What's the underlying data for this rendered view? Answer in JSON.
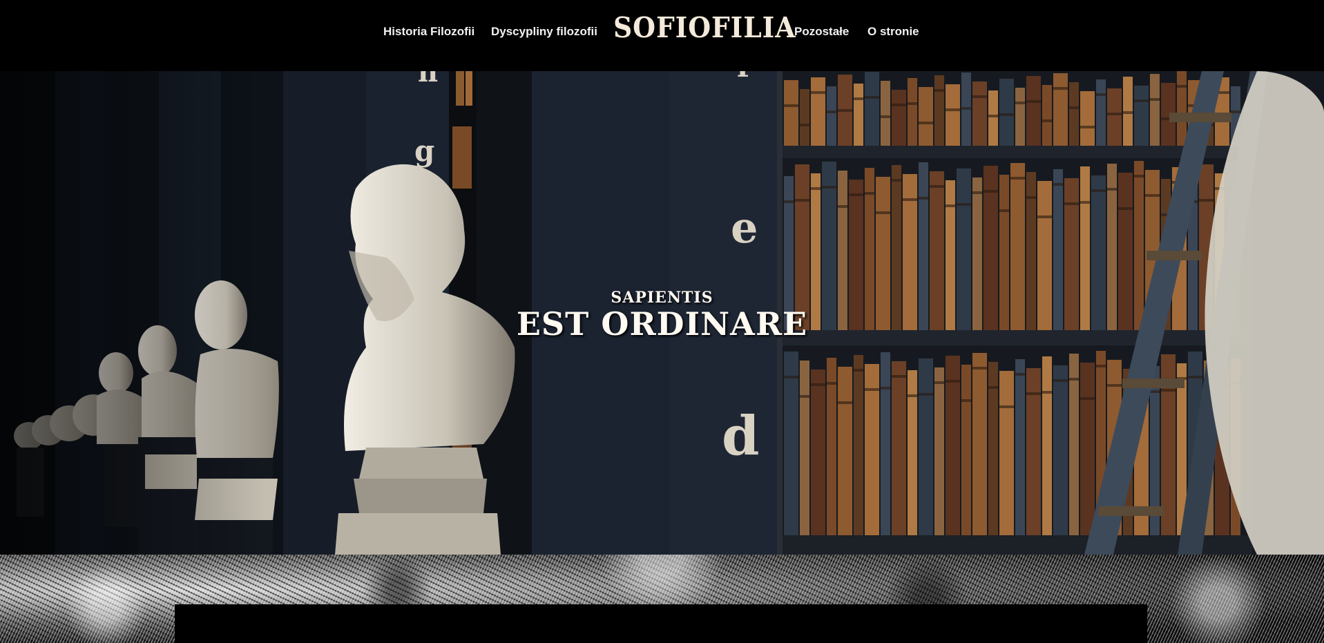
{
  "header": {
    "logo": "SOFIOFILIA",
    "nav_left": [
      "Historia Filozofii",
      "Dyscypliny filozofii"
    ],
    "nav_right": [
      "Pozostałe",
      "O stronie"
    ]
  },
  "hero": {
    "motto_small": "SAPIENTIS",
    "motto_big": "EST ORDINARE",
    "shelf_letters": [
      "h",
      "g",
      "f",
      "e",
      "d"
    ]
  },
  "colors": {
    "header_bg": "#000000",
    "nav_text": "#f2f2f2",
    "logo_text": "#f3eadb",
    "motto_text": "#fffaf2"
  }
}
